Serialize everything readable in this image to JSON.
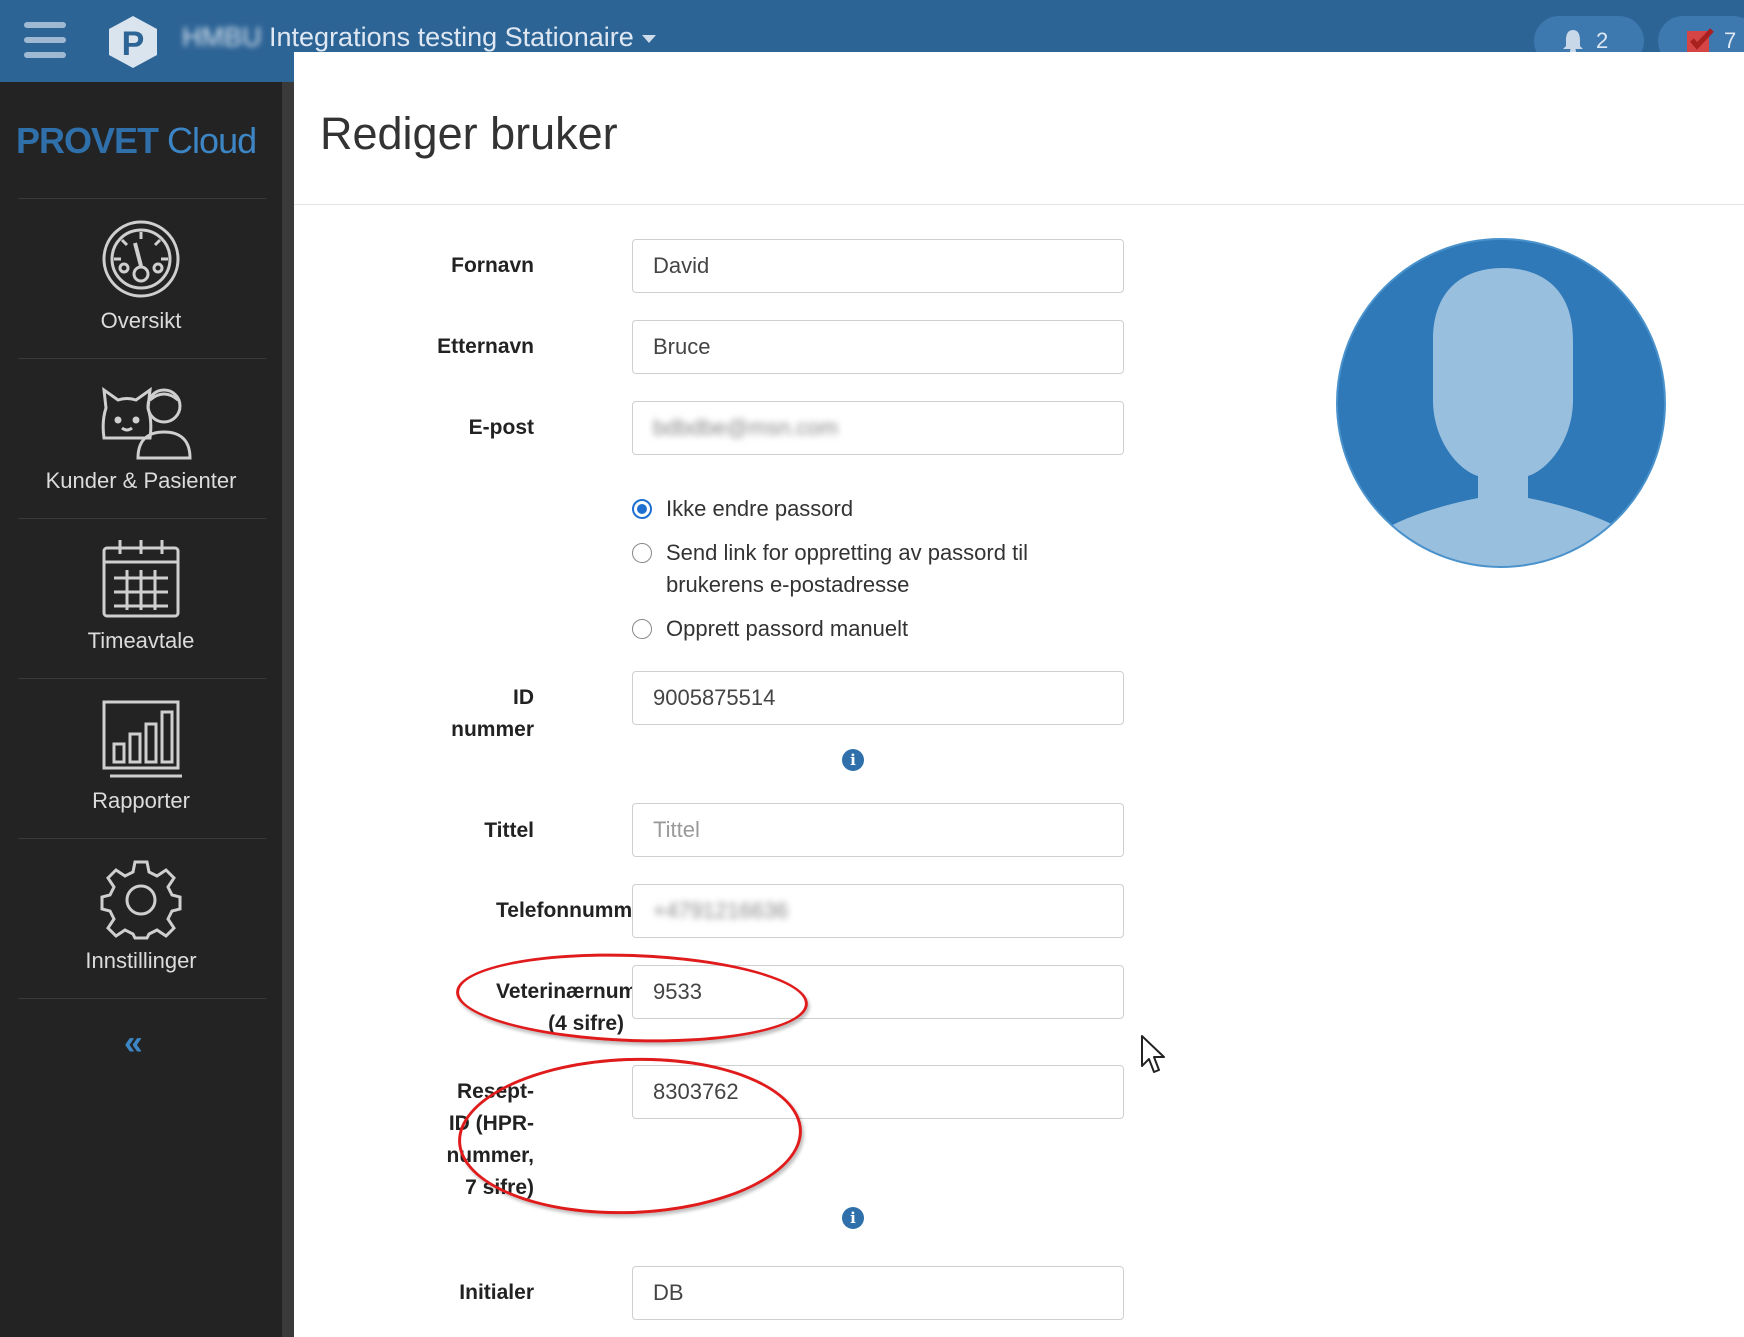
{
  "topbar": {
    "title_blurred": "HMBU",
    "title": "Integrations testing Stationaire",
    "notifications_count": "2",
    "tasks_count": "7"
  },
  "sidebar": {
    "brand_provet": "PROVET",
    "brand_cloud": "Cloud",
    "items": [
      {
        "label": "Oversikt",
        "icon": "speedometer-icon"
      },
      {
        "label": "Kunder & Pasienter",
        "icon": "cat-person-icon"
      },
      {
        "label": "Timeavtale",
        "icon": "calendar-icon"
      },
      {
        "label": "Rapporter",
        "icon": "bar-chart-icon"
      },
      {
        "label": "Innstillinger",
        "icon": "gear-icon"
      }
    ],
    "collapse_label": "‹‹"
  },
  "page": {
    "title": "Rediger bruker"
  },
  "form": {
    "first_name": {
      "label": "Fornavn",
      "value": "David"
    },
    "last_name": {
      "label": "Etternavn",
      "value": "Bruce"
    },
    "email": {
      "label": "E-post",
      "value": "bdbdbe@msn.com"
    },
    "password_options": [
      {
        "label": "Ikke endre passord",
        "selected": true
      },
      {
        "label": "Send link for oppretting av passord til brukerens e-postadresse",
        "selected": false
      },
      {
        "label": "Opprett passord manuelt",
        "selected": false
      }
    ],
    "id_number": {
      "label_line1": "ID",
      "label_line2": "nummer",
      "value": "9005875514"
    },
    "title_field": {
      "label": "Tittel",
      "placeholder": "Tittel"
    },
    "phone": {
      "label": "Telefonnummer",
      "value": "+4791216636"
    },
    "vet_number": {
      "label_line1": "Veterinærnummer",
      "label_line2": "(4 sifre)",
      "value": "9533"
    },
    "prescription_id": {
      "label_line1": "Resept-",
      "label_line2": "ID (HPR-",
      "label_line3": "nummer,",
      "label_line4": "7 sifre)",
      "value": "8303762"
    },
    "initials": {
      "label": "Initialer",
      "value": "DB"
    }
  },
  "colors": {
    "topbar": "#2d6496",
    "sidebar": "#232323",
    "accent": "#2f70ab",
    "annotation": "#e01b1b"
  }
}
